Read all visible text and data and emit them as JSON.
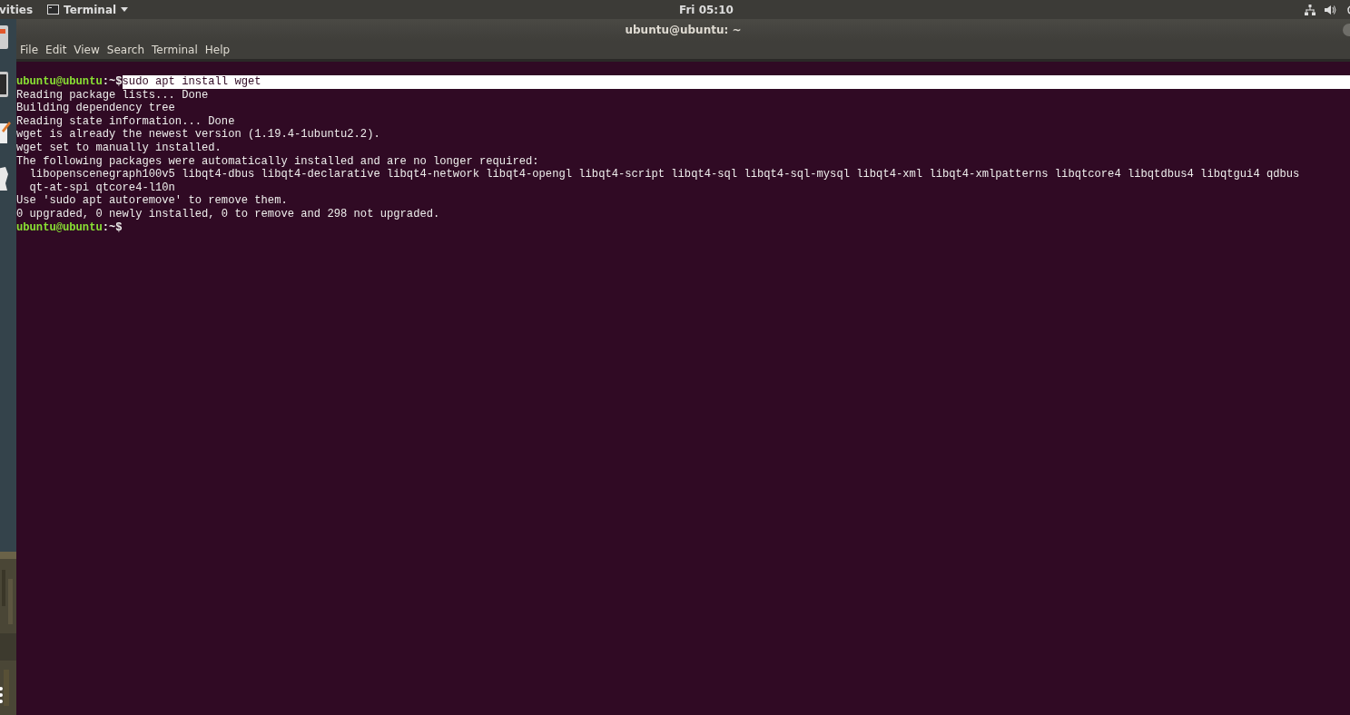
{
  "top_bar": {
    "activities": "vities",
    "app_menu": "Terminal",
    "clock": "Fri 05:10"
  },
  "window": {
    "title": "ubuntu@ubuntu: ~"
  },
  "menu": [
    "File",
    "Edit",
    "View",
    "Search",
    "Terminal",
    "Help"
  ],
  "terminal": {
    "lines": [
      {
        "kind": "prompt",
        "user": "ubuntu@ubuntu",
        "path": ":~$",
        "command": "sudo apt install wget",
        "highlighted": true
      },
      {
        "kind": "output",
        "text": "Reading package lists... Done"
      },
      {
        "kind": "output",
        "text": "Building dependency tree"
      },
      {
        "kind": "output",
        "text": "Reading state information... Done"
      },
      {
        "kind": "output",
        "text": "wget is already the newest version (1.19.4-1ubuntu2.2)."
      },
      {
        "kind": "output",
        "text": "wget set to manually installed."
      },
      {
        "kind": "output",
        "text": "The following packages were automatically installed and are no longer required:"
      },
      {
        "kind": "output",
        "text": "  libopenscenegraph100v5 libqt4-dbus libqt4-declarative libqt4-network libqt4-opengl libqt4-script libqt4-sql libqt4-sql-mysql libqt4-xml libqt4-xmlpatterns libqtcore4 libqtdbus4 libqtgui4 qdbus"
      },
      {
        "kind": "output",
        "text": "  qt-at-spi qtcore4-l10n"
      },
      {
        "kind": "output",
        "text": "Use 'sudo apt autoremove' to remove them."
      },
      {
        "kind": "output",
        "text": "0 upgraded, 0 newly installed, 0 to remove and 298 not upgraded."
      },
      {
        "kind": "prompt",
        "user": "ubuntu@ubuntu",
        "path": ":~$"
      }
    ]
  }
}
